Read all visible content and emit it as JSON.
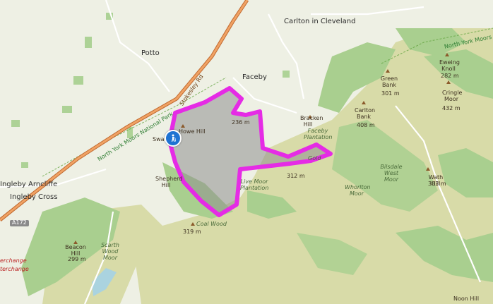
{
  "map": {
    "colors": {
      "background": "#f2efe9",
      "forest": "#a9cf8f",
      "moorland": "#d7d9a9",
      "farmland": "#e8ecdc",
      "route": "#e52be5",
      "route_fill": "#8f8f8f",
      "motorway": "#e8884a",
      "park_boundary": "#5fa33c"
    },
    "labels": {
      "potto": "Potto",
      "carlton": "Carlton in Cleveland",
      "faceby": "Faceby",
      "howe_hill": "Howe Hill",
      "swainby": "Swa",
      "shepherd_hill": "Shepherd Hill",
      "ingleby_arncliffe": "Ingleby Arncliffe",
      "ingleby_cross": "Ingleby Cross",
      "a172": "A172",
      "park_name_main": "North York Moors National Park",
      "park_name_ne": "North York Moors National Park",
      "road_a172": "Stokesley Rd",
      "peak_236": "236 m",
      "bracken_hill": "Bracken Hill",
      "faceby_plantation": "Faceby Plantation",
      "carlton_bank": "Carlton Bank",
      "carlton_bank_elev": "408 m",
      "green_bank": "Green Bank",
      "green_bank_elev": "301 m",
      "eweing_knoll": "Eweing Knoll",
      "eweing_knoll_elev": "282 m",
      "cringle_moor": "Cringle Moor",
      "cringle_moor_elev": "432 m",
      "whorlton_moor": "Whorlton Moor",
      "bilsdale_west_moor": "Bilsdale West Moor",
      "wath_hill": "Wath Hill",
      "wath_hill_elev": "303 m",
      "gold": "Gold",
      "elev_312": "312 m",
      "live_moor": "Live Moor Plantation",
      "coal_wood": "Coal Wood",
      "elev_319": "319 m",
      "beacon_hill": "Beacon Hill",
      "beacon_hill_elev": "299 m",
      "scarth_wood_moor": "Scarth Wood Moor",
      "interchange1": "erchange",
      "interchange2": "terchange",
      "noon_hill": "Noon Hill"
    },
    "icons": {
      "start_marker": "hiker-icon"
    }
  }
}
